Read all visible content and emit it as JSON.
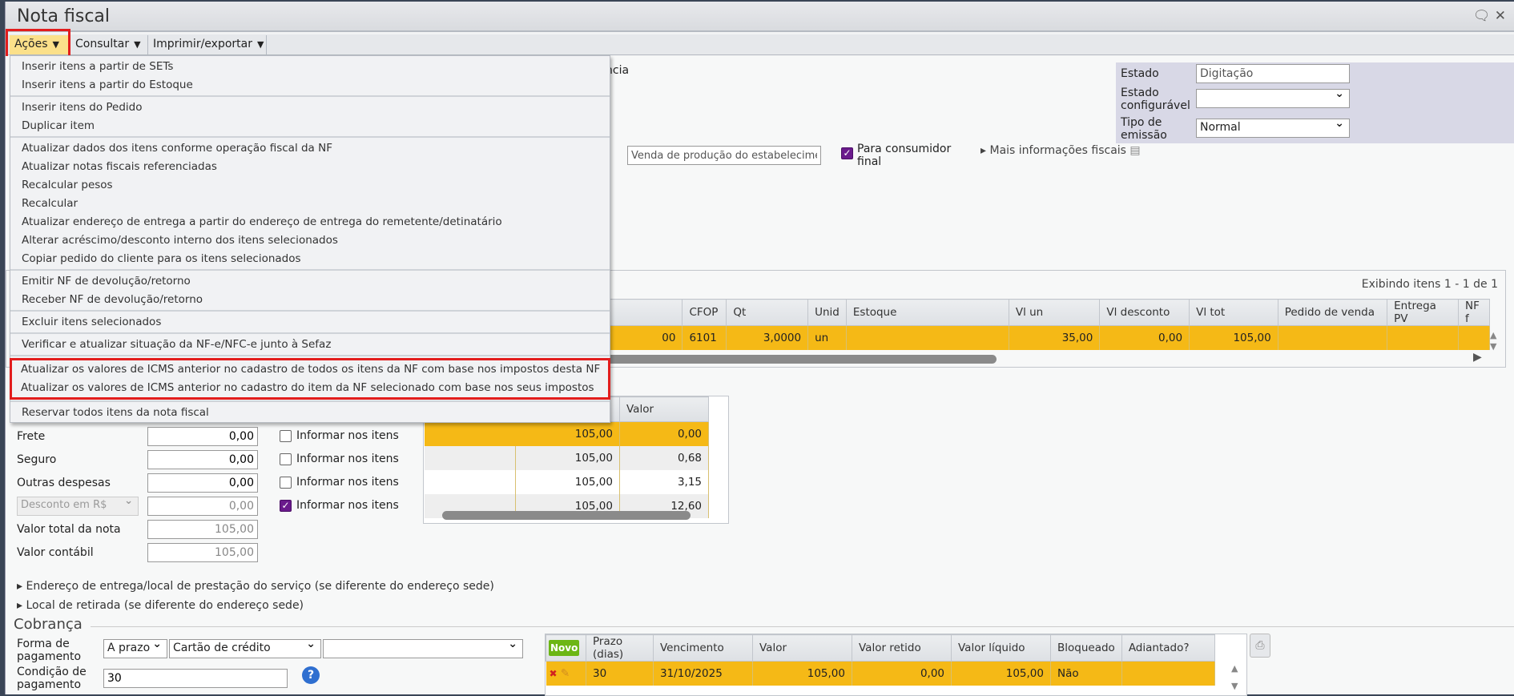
{
  "window": {
    "title": "Nota fiscal"
  },
  "toolbar": {
    "acoes": "Ações",
    "consultar": "Consultar",
    "imprimir": "Imprimir/exportar"
  },
  "menu": {
    "groups": [
      [
        "Inserir itens a partir de SETs",
        "Inserir itens a partir do Estoque"
      ],
      [
        "Inserir itens do Pedido",
        "Duplicar item"
      ],
      [
        "Atualizar dados dos itens conforme operação fiscal da NF",
        "Atualizar notas fiscais referenciadas",
        "Recalcular pesos",
        "Recalcular",
        "Atualizar endereço de entrega a partir do endereço de entrega do remetente/detinatário",
        "Alterar acréscimo/desconto interno dos itens selecionados",
        "Copiar pedido do cliente para os itens selecionados"
      ],
      [
        "Emitir NF de devolução/retorno",
        "Receber NF de devolução/retorno"
      ],
      [
        "Excluir itens selecionados"
      ],
      [
        "Verificar e atualizar situação da NF-e/NFC-e junto à Sefaz"
      ],
      [
        "Atualizar os valores de ICMS anterior no cadastro de todos os itens da NF com base nos impostos desta NF",
        "Atualizar os valores de ICMS anterior no cadastro do item da NF selecionado com base nos seus impostos"
      ],
      [
        "Reservar todos itens da nota fiscal"
      ]
    ]
  },
  "header": {
    "partial": "ncia",
    "estado_label": "Estado",
    "estado_value": "Digitação",
    "estado_conf_label": "Estado configurável",
    "estado_conf_value": "",
    "tipo_label": "Tipo de emissão",
    "tipo_value": "Normal",
    "natureza": "Venda de produção do estabelecime",
    "consumidor_final": "Para consumidor final",
    "mais_info": "Mais informações fiscais"
  },
  "items": {
    "count": "Exibindo itens 1 - 1 de 1",
    "columns": [
      "CFOP",
      "Qt",
      "Unid",
      "Estoque",
      "Vl un",
      "Vl desconto",
      "Vl tot",
      "Pedido de venda",
      "Entrega PV",
      "NF f"
    ],
    "rows": [
      [
        "00",
        "6101",
        "3,0000",
        "un",
        "",
        "35,00",
        "0,00",
        "105,00",
        "",
        "",
        ""
      ]
    ]
  },
  "totals": {
    "frete_label": "Frete",
    "frete": "0,00",
    "seguro_label": "Seguro",
    "seguro": "0,00",
    "outras_label": "Outras despesas",
    "outras": "0,00",
    "desconto_select": "Desconto em R$",
    "desconto": "0,00",
    "total_label": "Valor total da nota",
    "total": "105,00",
    "contabil_label": "Valor contábil",
    "contabil": "105,00",
    "informar": "Informar nos itens"
  },
  "taxes": {
    "column": "Valor",
    "rows": [
      [
        "105,00",
        "0,00"
      ],
      [
        "105,00",
        "0,68"
      ],
      [
        "105,00",
        "3,15"
      ],
      [
        "105,00",
        "12,60"
      ]
    ]
  },
  "sections": {
    "endereco": "Endereço de entrega/local de prestação do serviço (se diferente do endereço sede)",
    "retirada": "Local de retirada (se diferente do endereço sede)",
    "cobranca": "Cobrança"
  },
  "cobranca": {
    "forma_label": "Forma de pagamento",
    "forma1": "A prazo",
    "forma2": "Cartão de crédito",
    "forma3": "",
    "cond_label": "Condição de pagamento",
    "cond": "30",
    "novo": "Novo",
    "columns": [
      "Prazo (dias)",
      "Vencimento",
      "Valor",
      "Valor retido",
      "Valor líquido",
      "Bloqueado",
      "Adiantado?"
    ],
    "rows": [
      [
        "30",
        "31/10/2025",
        "105,00",
        "0,00",
        "105,00",
        "Não",
        ""
      ]
    ]
  },
  "colors": {
    "highlight": "#f5b916",
    "accent": "#6a1a8c",
    "alert": "#e21d1d"
  }
}
